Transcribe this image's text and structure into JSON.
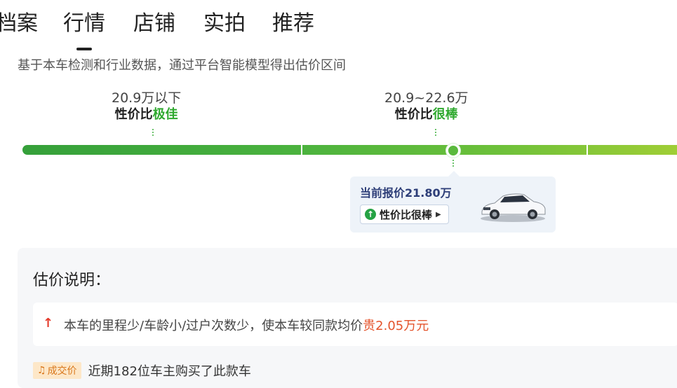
{
  "tabs": [
    {
      "label": "档案"
    },
    {
      "label": "行情"
    },
    {
      "label": "店铺"
    },
    {
      "label": "实拍"
    },
    {
      "label": "推荐"
    }
  ],
  "active_tab": "行情",
  "description": "基于本车检测和行业数据，通过平台智能模型得出估价区间",
  "tiers": [
    {
      "range": "20.9万以下",
      "verdict_prefix": "性价比",
      "verdict_highlight": "极佳"
    },
    {
      "range": "20.9~22.6万",
      "verdict_prefix": "性价比",
      "verdict_highlight": "很棒"
    }
  ],
  "current_price": {
    "label": "当前报价21.80万",
    "badge_label": "性价比很棒"
  },
  "explanation": {
    "title": "估价说明：",
    "reason_prefix": "本车的里程少/车龄小/过户次数少，使本车较同款均价",
    "reason_highlight": "贵2.05万元",
    "deal_badge": "成交价",
    "deal_text": "近期182位车主购买了此款车"
  },
  "colors": {
    "green_accent": "#2fa92f",
    "price_navy": "#2d3e78",
    "warn_red": "#e4542c"
  }
}
